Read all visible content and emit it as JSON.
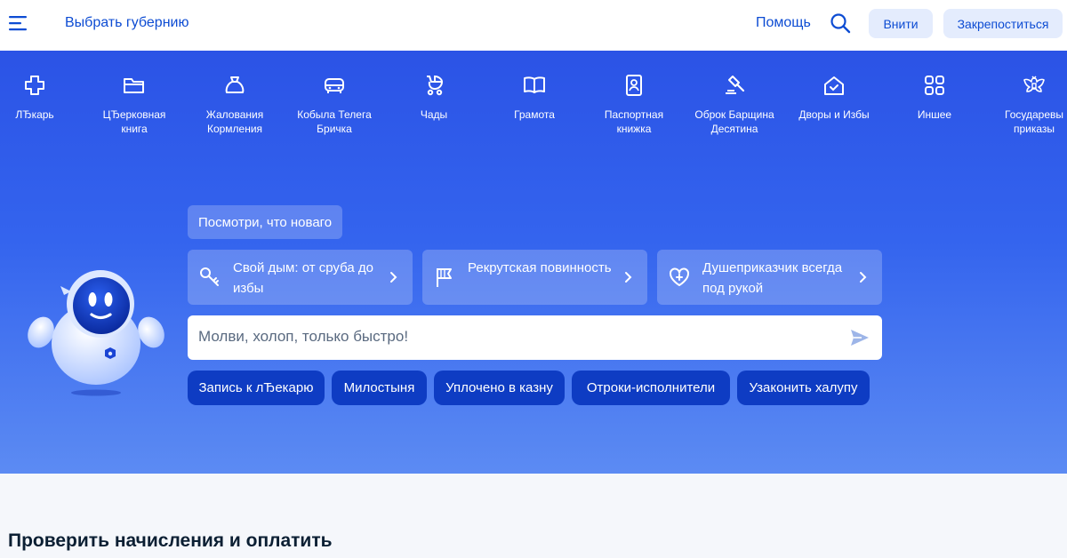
{
  "header": {
    "region_label": "Выбрать губернию",
    "help_label": "Помощь",
    "login_label": "Внити",
    "register_label": "Закрепоститься"
  },
  "categories": [
    {
      "label": "ЛЂкарь",
      "icon": "medical-cross-icon"
    },
    {
      "label": "ЦЂерковная книга",
      "icon": "folder-icon"
    },
    {
      "label": "Жалования Кормления",
      "icon": "money-bag-icon"
    },
    {
      "label": "Кобыла Телега Бричка",
      "icon": "car-icon"
    },
    {
      "label": "Чады",
      "icon": "stroller-icon"
    },
    {
      "label": "Грамота",
      "icon": "book-icon"
    },
    {
      "label": "Паспортная книжка",
      "icon": "passport-icon"
    },
    {
      "label": "Оброк Барщина Десятина",
      "icon": "gavel-icon"
    },
    {
      "label": "Дворы и Избы",
      "icon": "house-icon"
    },
    {
      "label": "Иншее",
      "icon": "grid-icon"
    },
    {
      "label": "Государевы приказы",
      "icon": "eagle-emblem-icon"
    }
  ],
  "assistant": {
    "whats_new": "Посмотри, что новаго",
    "cards": [
      {
        "label": "Свой дым: от сруба до избы",
        "icon": "key-icon"
      },
      {
        "label": "Рекрутская повинность",
        "icon": "flag-icon"
      },
      {
        "label": "Душеприказчик всегда под рукой",
        "icon": "heart-plus-icon"
      }
    ],
    "placeholder": "Молви, холоп, только быстро!",
    "quick_actions": [
      "Запись к лЂекарю",
      "Милостыня",
      "Уплочено в казну",
      "Отроки-исполнители",
      "Узаконить халупу"
    ]
  },
  "section": {
    "title": "Проверить начисления и оплатить"
  },
  "colors": {
    "brand_blue": "#0d4cd3",
    "hero_top": "#2b53e6",
    "hero_bottom": "#5c8bf3",
    "quick_button": "#0e3cc3",
    "light_button": "#e4ecfd"
  }
}
